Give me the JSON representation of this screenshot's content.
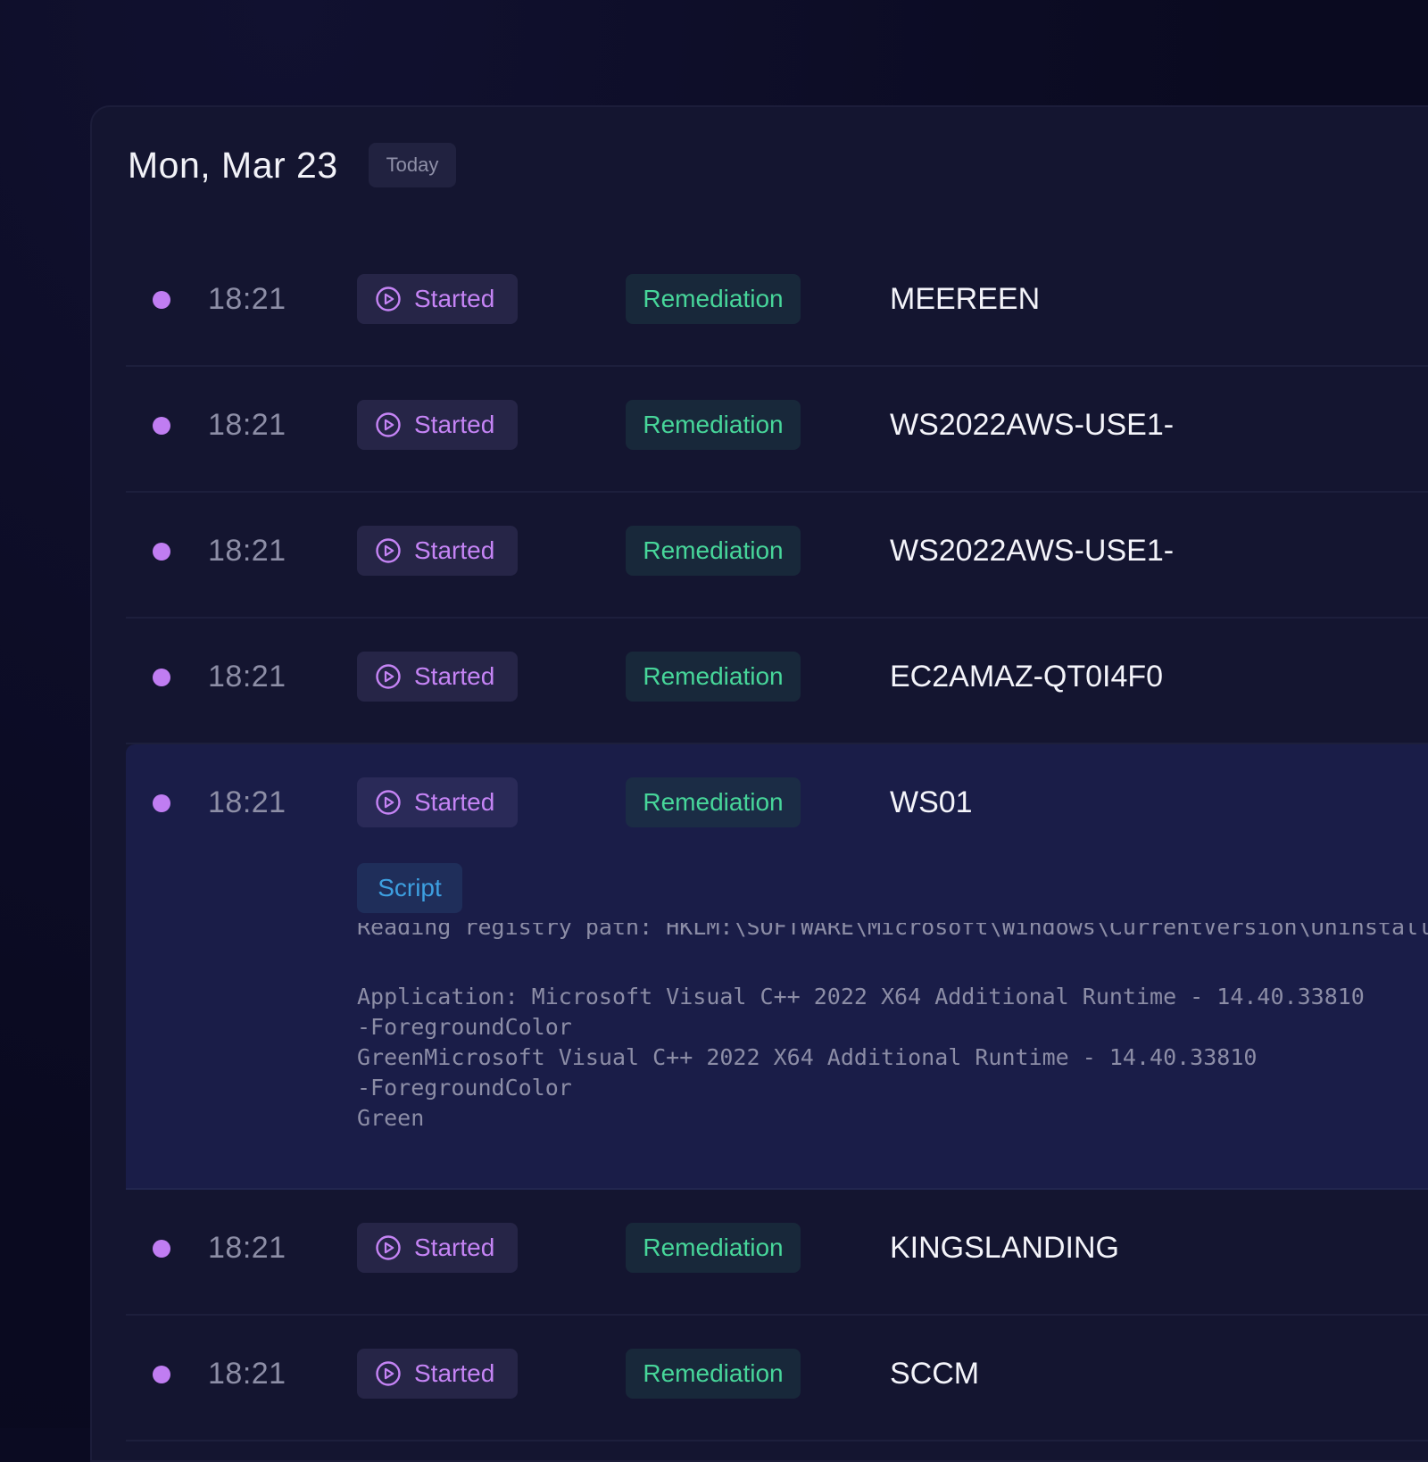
{
  "header": {
    "date": "Mon, Mar 23",
    "today_label": "Today"
  },
  "colors": {
    "status_text": "#c584f5",
    "type_text": "#47d69a",
    "script_text": "#3d9fe0",
    "dot": "#c07df2"
  },
  "rows": [
    {
      "time": "18:21",
      "status": "Started",
      "type": "Remediation",
      "host": "MEEREEN",
      "status_icon": "play-circle-icon"
    },
    {
      "time": "18:21",
      "status": "Started",
      "type": "Remediation",
      "host": "WS2022AWS-USE1-",
      "status_icon": "play-circle-icon"
    },
    {
      "time": "18:21",
      "status": "Started",
      "type": "Remediation",
      "host": "WS2022AWS-USE1-",
      "status_icon": "play-circle-icon"
    },
    {
      "time": "18:21",
      "status": "Started",
      "type": "Remediation",
      "host": "EC2AMAZ-QT0I4F0",
      "status_icon": "play-circle-icon"
    },
    {
      "time": "18:21",
      "status": "Started",
      "type": "Remediation",
      "host": "WS01",
      "status_icon": "play-circle-icon",
      "expanded": {
        "tag": "Script",
        "output_clipped": "Reading registry path: HKLM:\\SOFTWARE\\Microsoft\\Windows\\CurrentVersion\\Uninstall",
        "output": "Application: Microsoft Visual C++ 2022 X64 Additional Runtime - 14.40.33810\n-ForegroundColor\nGreenMicrosoft Visual C++ 2022 X64 Additional Runtime - 14.40.33810\n-ForegroundColor\nGreen"
      }
    },
    {
      "time": "18:21",
      "status": "Started",
      "type": "Remediation",
      "host": "KINGSLANDING",
      "status_icon": "play-circle-icon"
    },
    {
      "time": "18:21",
      "status": "Started",
      "type": "Remediation",
      "host": "SCCM",
      "status_icon": "play-circle-icon"
    }
  ]
}
